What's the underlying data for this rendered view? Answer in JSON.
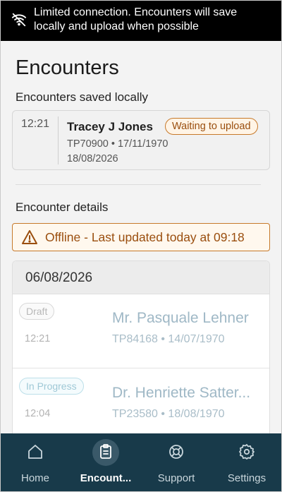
{
  "banner": {
    "line1": "Limited connection. Encounters will save",
    "line2": "locally and upload when possible",
    "icon": "wifi-off-icon"
  },
  "page": {
    "title": "Encounters",
    "saved_label": "Encounters saved locally",
    "details_label": "Encounter details"
  },
  "local_encounter": {
    "time": "12:21",
    "name": "Tracey J Jones",
    "meta": "TP70900 • 17/11/1970",
    "date": "18/08/2026",
    "badge": "Waiting to upload"
  },
  "alert": {
    "text": "Offline - Last updated today at 09:18",
    "icon": "warning-icon"
  },
  "group": {
    "date": "06/08/2026",
    "rows": [
      {
        "status": "Draft",
        "time": "12:21",
        "name": "Mr. Pasquale Lehner",
        "meta": "TP84168 • 14/07/1970"
      },
      {
        "status": "In Progress",
        "time": "12:04",
        "name": "Dr. Henriette Satter...",
        "meta": "TP23580 • 18/08/1970"
      }
    ]
  },
  "nav": {
    "items": [
      {
        "label": "Home",
        "icon": "home-icon"
      },
      {
        "label": "Encount...",
        "icon": "clipboard-icon"
      },
      {
        "label": "Support",
        "icon": "lifebuoy-icon"
      },
      {
        "label": "Settings",
        "icon": "gear-icon"
      }
    ]
  },
  "colors": {
    "nav_bg": "#183a4a",
    "warning": "#c7792a",
    "warning_text": "#9a4e0e"
  }
}
